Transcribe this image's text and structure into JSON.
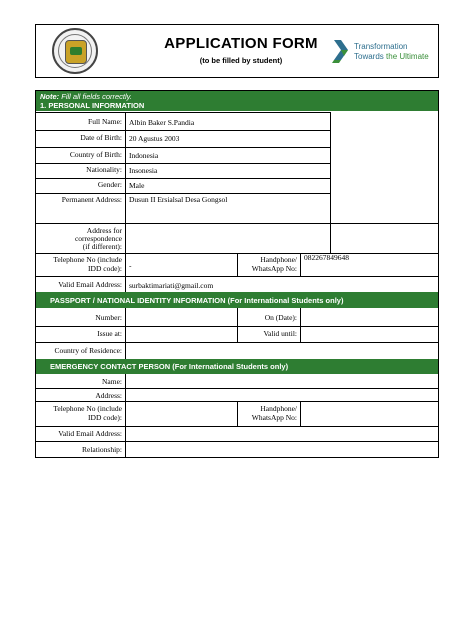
{
  "header": {
    "title": "APPLICATION FORM",
    "subtitle": "(to be filled by student)",
    "brand_line1": "Transformation",
    "brand_line2a": "Towards ",
    "brand_line2b": "the Ultimate",
    "brand_color": "#2e6f8e",
    "accent_color": "#3a8f3a"
  },
  "note": {
    "label": "Note:",
    "text": " Fill all fields correctly."
  },
  "sections": {
    "personal": "1.  PERSONAL INFORMATION",
    "passport": "PASSPORT / NATIONAL IDENTITY INFORMATION (For International Students only)",
    "emergency": "EMERGENCY CONTACT PERSON (For International Students only)"
  },
  "personal": {
    "full_name": {
      "label": "Full Name:",
      "value": "Albin Baker S.Pandia"
    },
    "dob": {
      "label": "Date of Birth:",
      "value": "20 Agustus 2003"
    },
    "country_birth": {
      "label": "Country of Birth:",
      "value": "Indonesia"
    },
    "nationality": {
      "label": "Nationality:",
      "value": "Insonesia"
    },
    "gender": {
      "label": "Gender:",
      "value": "Male"
    },
    "permanent_address": {
      "label": "Permanent Address:",
      "value": "Dusun II Ersialsal Desa Gongsol"
    },
    "corr_address": {
      "label_1": "Address for",
      "label_2": "correspondence",
      "label_3": "(if different):"
    },
    "telephone": {
      "label_1": "Telephone No (include",
      "label_2": "IDD code):",
      "value": "-"
    },
    "handphone": {
      "label_1": "Handphone/",
      "label_2": "WhatsApp No:",
      "value": "082267849648"
    },
    "email": {
      "label": "Valid Email Address:",
      "value": "surbaktimariati@gmail.com"
    }
  },
  "passport": {
    "number": "Number:",
    "on_date": "On (Date):",
    "issue_at": "Issue at:",
    "valid_until": "Valid until:",
    "country_residence": "Country of Residence:"
  },
  "emergency": {
    "name": "Name:",
    "address": "Address:",
    "telephone_1": "Telephone No (include",
    "telephone_2": "IDD code):",
    "handphone_1": "Handphone/",
    "handphone_2": "WhatsApp No:",
    "email": "Valid Email Address:",
    "relationship": "Relationship:"
  },
  "colors": {
    "section_green": "#2e7d32"
  }
}
